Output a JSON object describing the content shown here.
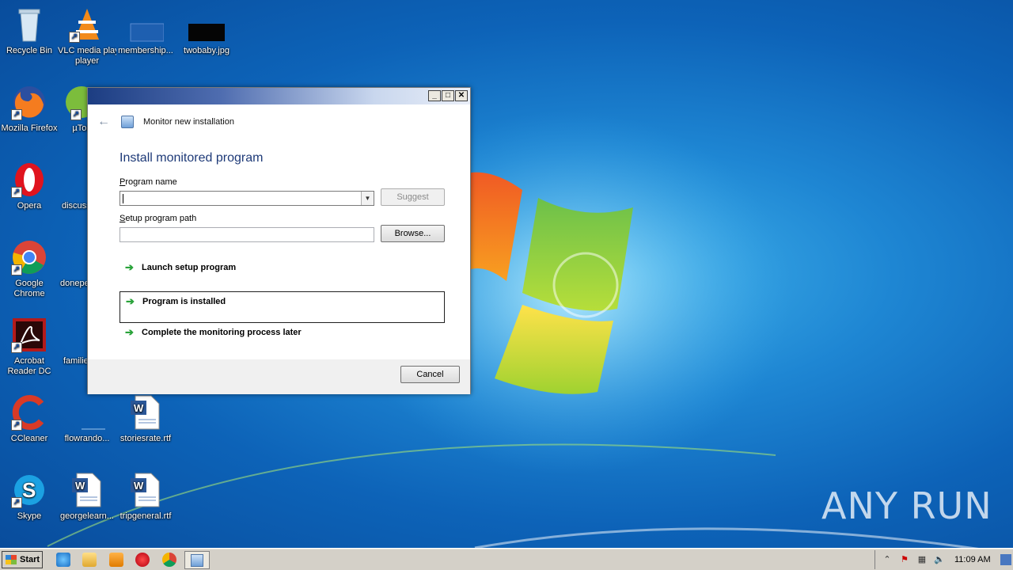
{
  "desktop": {
    "icons": [
      {
        "label": "Recycle Bin",
        "icon": "recycle-bin-icon"
      },
      {
        "label": "VLC media player",
        "icon": "vlc-icon"
      },
      {
        "label": "membership...",
        "icon": "file-thumbnail-icon"
      },
      {
        "label": "twobaby.jpg",
        "icon": "image-thumbnail-icon"
      },
      {
        "label": "Mozilla Firefox",
        "icon": "firefox-icon"
      },
      {
        "label": "µTor",
        "icon": "utorrent-icon"
      },
      {
        "label": "Opera",
        "icon": "opera-icon"
      },
      {
        "label": "discuss",
        "icon": "file-icon"
      },
      {
        "label": "Google Chrome",
        "icon": "chrome-icon"
      },
      {
        "label": "donepe",
        "icon": "file-icon"
      },
      {
        "label": "Acrobat Reader DC",
        "icon": "acrobat-icon"
      },
      {
        "label": "familie",
        "icon": "file-icon"
      },
      {
        "label": "CCleaner",
        "icon": "ccleaner-icon"
      },
      {
        "label": "flowrando...",
        "icon": "file-icon"
      },
      {
        "label": "storiesrate.rtf",
        "icon": "word-doc-icon"
      },
      {
        "label": "Skype",
        "icon": "skype-icon"
      },
      {
        "label": "georgelearn...",
        "icon": "word-doc-icon"
      },
      {
        "label": "tripgeneral.rtf",
        "icon": "word-doc-icon"
      }
    ]
  },
  "dialog": {
    "nav_title": "Monitor new installation",
    "heading": "Install monitored program",
    "program_name_label_prefix": "P",
    "program_name_label_rest": "rogram name",
    "program_name_value": "",
    "suggest_label": "Suggest",
    "setup_path_label_prefix": "S",
    "setup_path_label_rest": "etup program path",
    "setup_path_value": "",
    "browse_label": "Browse...",
    "links": {
      "launch": "Launch setup program",
      "installed": "Program is installed",
      "later": "Complete the monitoring process later"
    },
    "cancel_label": "Cancel"
  },
  "taskbar": {
    "start_label": "Start",
    "clock": "11:09 AM"
  },
  "watermark": "ANY RUN"
}
